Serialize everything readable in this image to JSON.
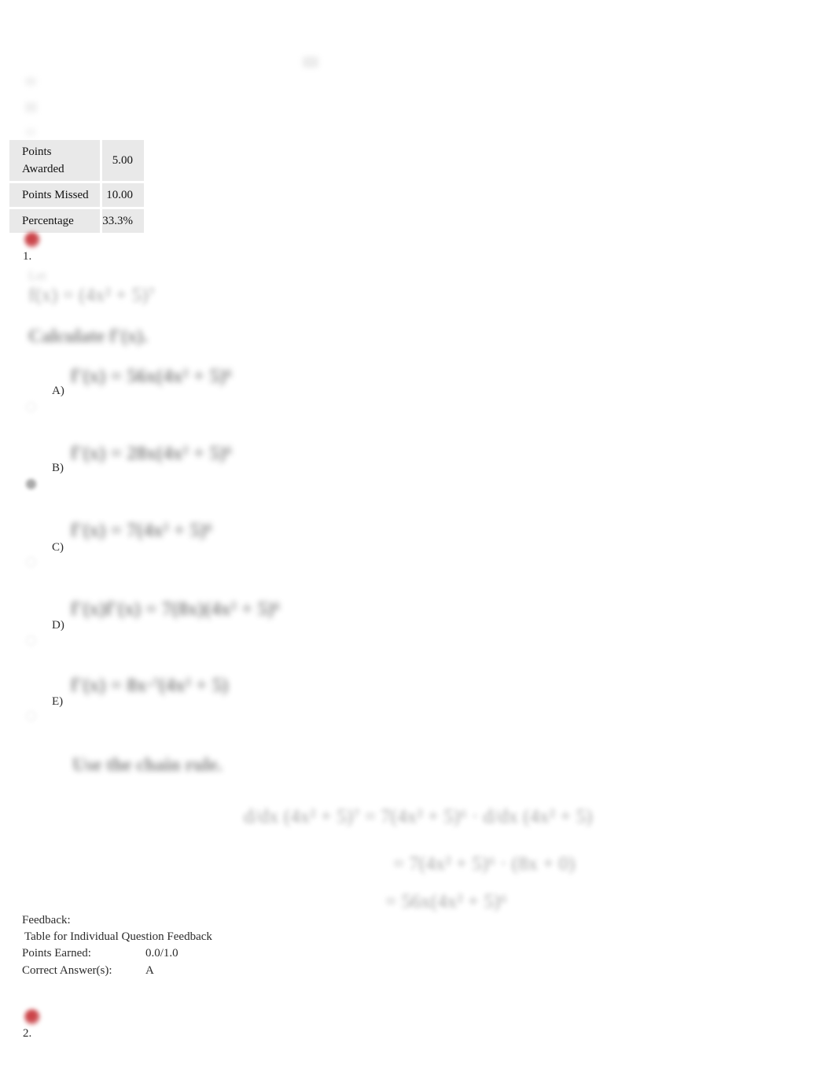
{
  "document": {
    "type": "quiz-results",
    "accent_red": "#c9454a",
    "table_bg": "#e9e9e9"
  },
  "score_summary": {
    "rows": [
      {
        "label": "Points Awarded",
        "value": "5.00"
      },
      {
        "label": "Points Missed",
        "value": "10.00"
      },
      {
        "label": "Percentage",
        "value": "33.3%"
      }
    ]
  },
  "questions": [
    {
      "number": "1.",
      "status_icon": "incorrect-red-dot-icon",
      "prompt_label": "Let",
      "prompt_expression": "f(x) = (4x² + 5)⁷",
      "instruction": "Calculate f′(x).",
      "options": [
        {
          "letter": "A)",
          "expression": "f′(x) = 56x(4x² + 5)⁶",
          "selected": false
        },
        {
          "letter": "B)",
          "expression": "f′(x) = 28x(4x² + 5)⁶",
          "selected": true
        },
        {
          "letter": "C)",
          "expression": "f′(x) = 7(4x² + 5)⁶",
          "selected": false
        },
        {
          "letter": "D)",
          "expression": "f′(x)f′(x) = 7(8x)(4x² + 5)⁶",
          "selected": false
        },
        {
          "letter": "E)",
          "expression": "f′(x) = 8x·⁷(4x² + 5)",
          "selected": false
        }
      ],
      "solution": {
        "heading": "Use the chain rule.",
        "lines": [
          "d/dx (4x² + 5)⁷ = 7(4x² + 5)⁶ · d/dx (4x² + 5)",
          "= 7(4x² + 5)⁶ · (8x + 0)",
          "= 56x(4x² + 5)⁶"
        ]
      },
      "feedback": {
        "heading": "Feedback:",
        "table_caption": "Table for Individual Question Feedback",
        "points_earned_label": "Points Earned:",
        "points_earned_value": "0.0/1.0",
        "correct_answer_label": "Correct Answer(s):",
        "correct_answer_value": "A"
      }
    },
    {
      "number": "2.",
      "status_icon": "incorrect-red-dot-icon"
    }
  ]
}
